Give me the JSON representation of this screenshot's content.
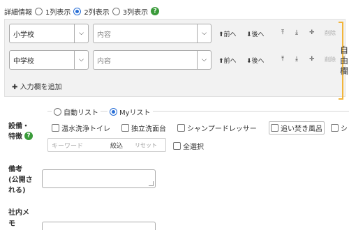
{
  "detail": {
    "label": "詳細情報",
    "options": [
      "1列表示",
      "2列表示",
      "3列表示"
    ],
    "selected_index": 1
  },
  "rows": [
    {
      "school": "小学校",
      "content_placeholder": "内容"
    },
    {
      "school": "中学校",
      "content_placeholder": "内容"
    }
  ],
  "row_actions": {
    "front": "前へ",
    "back": "後へ",
    "delete": "削除"
  },
  "add_row_label": "入力欄を追加",
  "side_text": [
    "自",
    "由",
    "欄"
  ],
  "equipment": {
    "label_line1": "設備・",
    "label_line2": "特徴",
    "mode_options": [
      "自動リスト",
      "Myリスト"
    ],
    "mode_selected": 1,
    "features": [
      "温水洗浄トイレ",
      "独立洗面台",
      "シャンプードレッサー",
      "追い焚き風呂",
      "シ"
    ],
    "keyword_placeholder": "キーワード",
    "narrow_label": "絞込",
    "reset_label": "リセット",
    "select_all_label": "全選択"
  },
  "remarks": {
    "label_lines": [
      "備考",
      "(公開さ",
      "れる)"
    ]
  },
  "internal_memo": {
    "label_lines": [
      "社内メ",
      "モ"
    ]
  }
}
